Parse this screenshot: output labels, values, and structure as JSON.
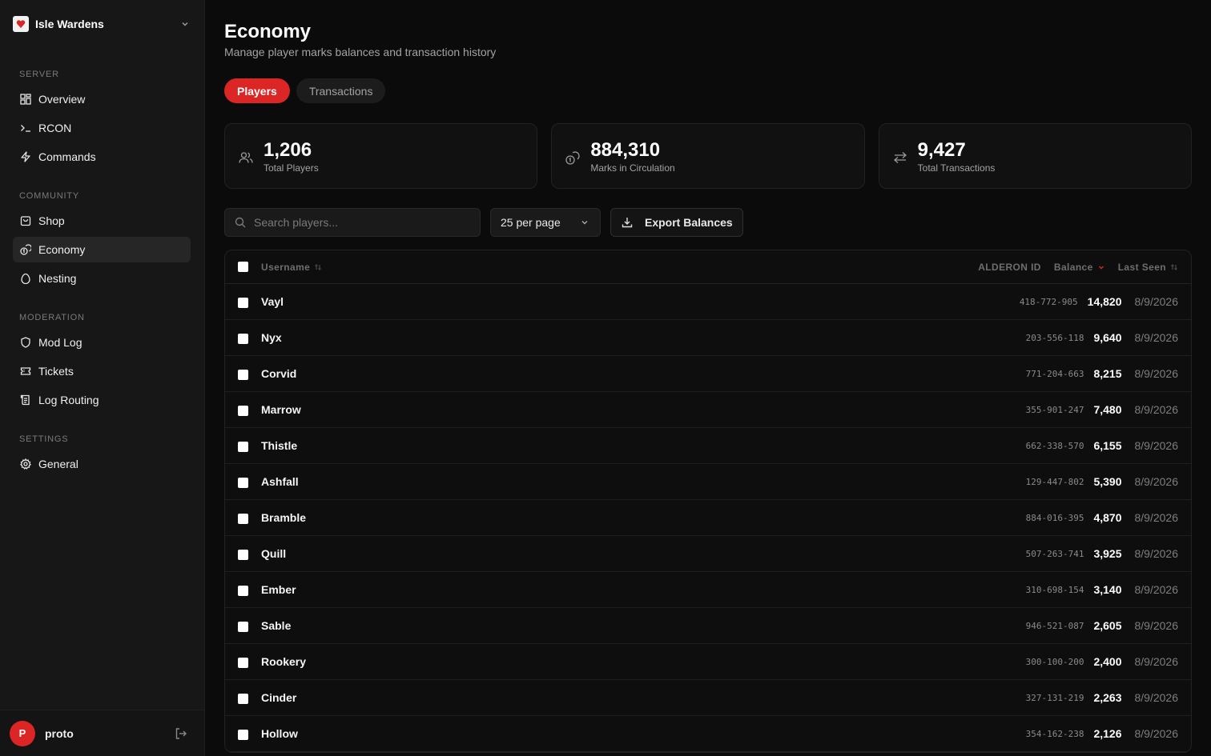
{
  "sidebar": {
    "brand": "Isle Wardens",
    "sections": [
      {
        "label": "SERVER",
        "items": [
          {
            "label": "Overview",
            "icon": "grid-icon"
          },
          {
            "label": "RCON",
            "icon": "terminal-icon"
          },
          {
            "label": "Commands",
            "icon": "bolt-icon"
          }
        ]
      },
      {
        "label": "COMMUNITY",
        "items": [
          {
            "label": "Shop",
            "icon": "shopping-bag-icon"
          },
          {
            "label": "Economy",
            "icon": "coins-icon"
          },
          {
            "label": "Nesting",
            "icon": "egg-icon"
          }
        ]
      },
      {
        "label": "MODERATION",
        "items": [
          {
            "label": "Mod Log",
            "icon": "shield-icon"
          },
          {
            "label": "Tickets",
            "icon": "ticket-icon"
          },
          {
            "label": "Log Routing",
            "icon": "scroll-icon"
          }
        ]
      },
      {
        "label": "SETTINGS",
        "items": [
          {
            "label": "General",
            "icon": "gear-icon"
          }
        ]
      }
    ],
    "active_item": "Economy",
    "user": {
      "initial": "P",
      "name": "proto"
    }
  },
  "page": {
    "title": "Economy",
    "subtitle": "Manage player marks balances and transaction history"
  },
  "tabs": [
    {
      "label": "Players",
      "active": true
    },
    {
      "label": "Transactions",
      "active": false
    }
  ],
  "stats": [
    {
      "value": "1,206",
      "label": "Total Players",
      "icon": "users-icon"
    },
    {
      "value": "884,310",
      "label": "Marks in Circulation",
      "icon": "coins-icon"
    },
    {
      "value": "9,427",
      "label": "Total Transactions",
      "icon": "swap-arrows-icon"
    }
  ],
  "toolbar": {
    "search_placeholder": "Search players...",
    "per_page": "25 per page",
    "export_label": "Export Balances"
  },
  "table": {
    "headers": {
      "username": "Username",
      "alderon_id": "ALDERON ID",
      "balance": "Balance",
      "last_seen": "Last Seen"
    },
    "rows": [
      {
        "username": "Vayl",
        "alderon_id": "418-772-905",
        "balance": "14,820",
        "last_seen": "8/9/2026"
      },
      {
        "username": "Nyx",
        "alderon_id": "203-556-118",
        "balance": "9,640",
        "last_seen": "8/9/2026"
      },
      {
        "username": "Corvid",
        "alderon_id": "771-204-663",
        "balance": "8,215",
        "last_seen": "8/9/2026"
      },
      {
        "username": "Marrow",
        "alderon_id": "355-901-247",
        "balance": "7,480",
        "last_seen": "8/9/2026"
      },
      {
        "username": "Thistle",
        "alderon_id": "662-338-570",
        "balance": "6,155",
        "last_seen": "8/9/2026"
      },
      {
        "username": "Ashfall",
        "alderon_id": "129-447-802",
        "balance": "5,390",
        "last_seen": "8/9/2026"
      },
      {
        "username": "Bramble",
        "alderon_id": "884-016-395",
        "balance": "4,870",
        "last_seen": "8/9/2026"
      },
      {
        "username": "Quill",
        "alderon_id": "507-263-741",
        "balance": "3,925",
        "last_seen": "8/9/2026"
      },
      {
        "username": "Ember",
        "alderon_id": "310-698-154",
        "balance": "3,140",
        "last_seen": "8/9/2026"
      },
      {
        "username": "Sable",
        "alderon_id": "946-521-087",
        "balance": "2,605",
        "last_seen": "8/9/2026"
      },
      {
        "username": "Rookery",
        "alderon_id": "300-100-200",
        "balance": "2,400",
        "last_seen": "8/9/2026"
      },
      {
        "username": "Cinder",
        "alderon_id": "327-131-219",
        "balance": "2,263",
        "last_seen": "8/9/2026"
      },
      {
        "username": "Hollow",
        "alderon_id": "354-162-238",
        "balance": "2,126",
        "last_seen": "8/9/2026"
      }
    ]
  },
  "colors": {
    "accent": "#dc2626",
    "background": "#0b0b0b",
    "sidebar": "#171717"
  }
}
